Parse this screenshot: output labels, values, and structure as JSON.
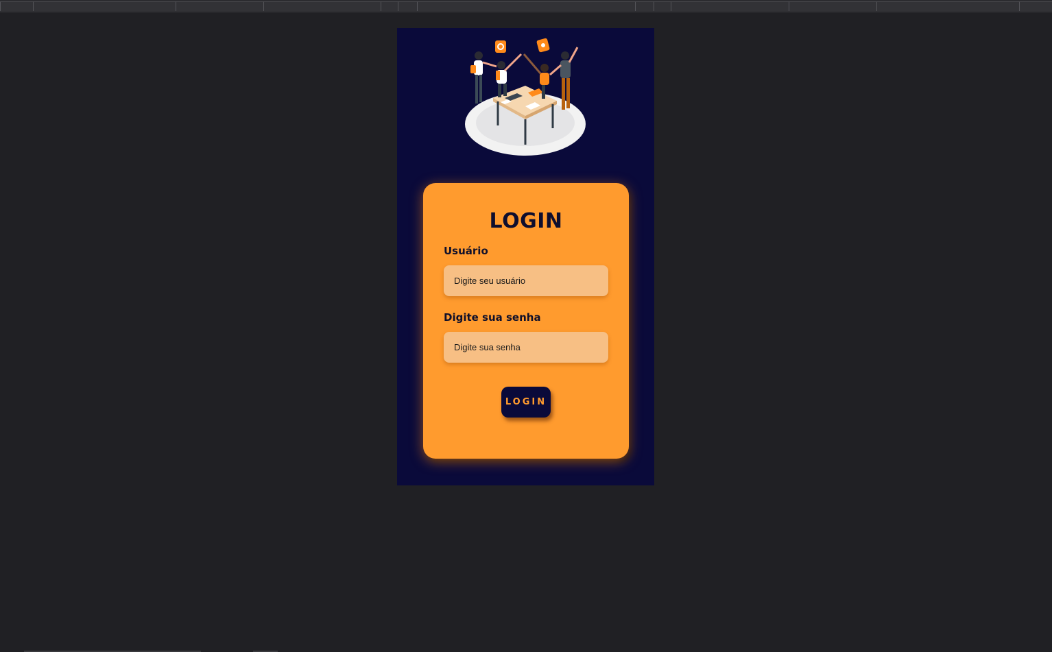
{
  "login": {
    "title": "LOGIN",
    "username_label": "Usuário",
    "username_placeholder": "Digite seu usuário",
    "password_label": "Digite sua senha",
    "password_placeholder": "Digite sua senha",
    "button_label": "LOGIN"
  },
  "illustration": {
    "icon": "team-high-five-illustration"
  },
  "colors": {
    "page_bg": "#202024",
    "panel_bg": "#0a0a3a",
    "card_bg": "#ff9b2e",
    "input_bg": "#f7bf84",
    "text_dark": "#0e0e2e",
    "button_text": "#ff9b2e"
  }
}
